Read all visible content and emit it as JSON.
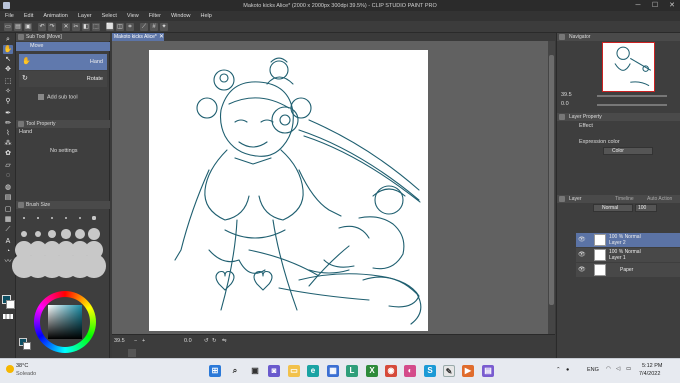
{
  "window": {
    "title": "Makoto kicks Alice* (2000 x 2000px 300dpi 39.5%) - CLIP STUDIO PAINT PRO",
    "minimize": "─",
    "maximize": "☐",
    "close": "✕"
  },
  "menu": [
    "File",
    "Edit",
    "Animation",
    "Layer",
    "Select",
    "View",
    "Filter",
    "Window",
    "Help"
  ],
  "left_panel": {
    "subtool_header": "Sub Tool [Move]",
    "subtool_tab": "Move",
    "subtool_items": [
      "Hand",
      "Rotate"
    ],
    "add_subtool": "Add sub tool",
    "tool_property_header": "Tool Property",
    "tool_property_tab": "Hand",
    "no_settings": "No settings",
    "brush_size_header": "Brush Size"
  },
  "document_tab": {
    "label": "Makoto kicks Alice*",
    "close": "✕"
  },
  "status": {
    "zoom": "39.5",
    "angle": "0.0"
  },
  "right_panel": {
    "navigator_header": "Navigator",
    "navigator_zoom": "39.5",
    "navigator_angle": "0.0",
    "layer_property_header": "Layer Property",
    "effect_label": "Effect",
    "expression_color_label": "Expression color",
    "expression_color_value": "Color",
    "layer_header": "Layer",
    "layer_tabs": [
      "Timeline",
      "Auto Action"
    ],
    "blend_mode": "Normal",
    "opacity": "100",
    "layers": [
      {
        "opacity_mode": "100 % Normal",
        "name": "Layer 2",
        "selected": true
      },
      {
        "opacity_mode": "100 % Normal",
        "name": "Layer 1",
        "selected": false
      },
      {
        "opacity_mode": "",
        "name": "Paper",
        "selected": false
      }
    ]
  },
  "colors": {
    "main_color": "#0e4f63",
    "selection_blue": "#5b73a5",
    "sketch_stroke": "#1f5f70",
    "taskbar_bg": "#e7eaf0"
  },
  "taskbar": {
    "weather_temp": "38°C",
    "weather_desc": "Soleado",
    "lang": "ENG",
    "time": "5:12 PM",
    "date": "7/4/2022"
  }
}
